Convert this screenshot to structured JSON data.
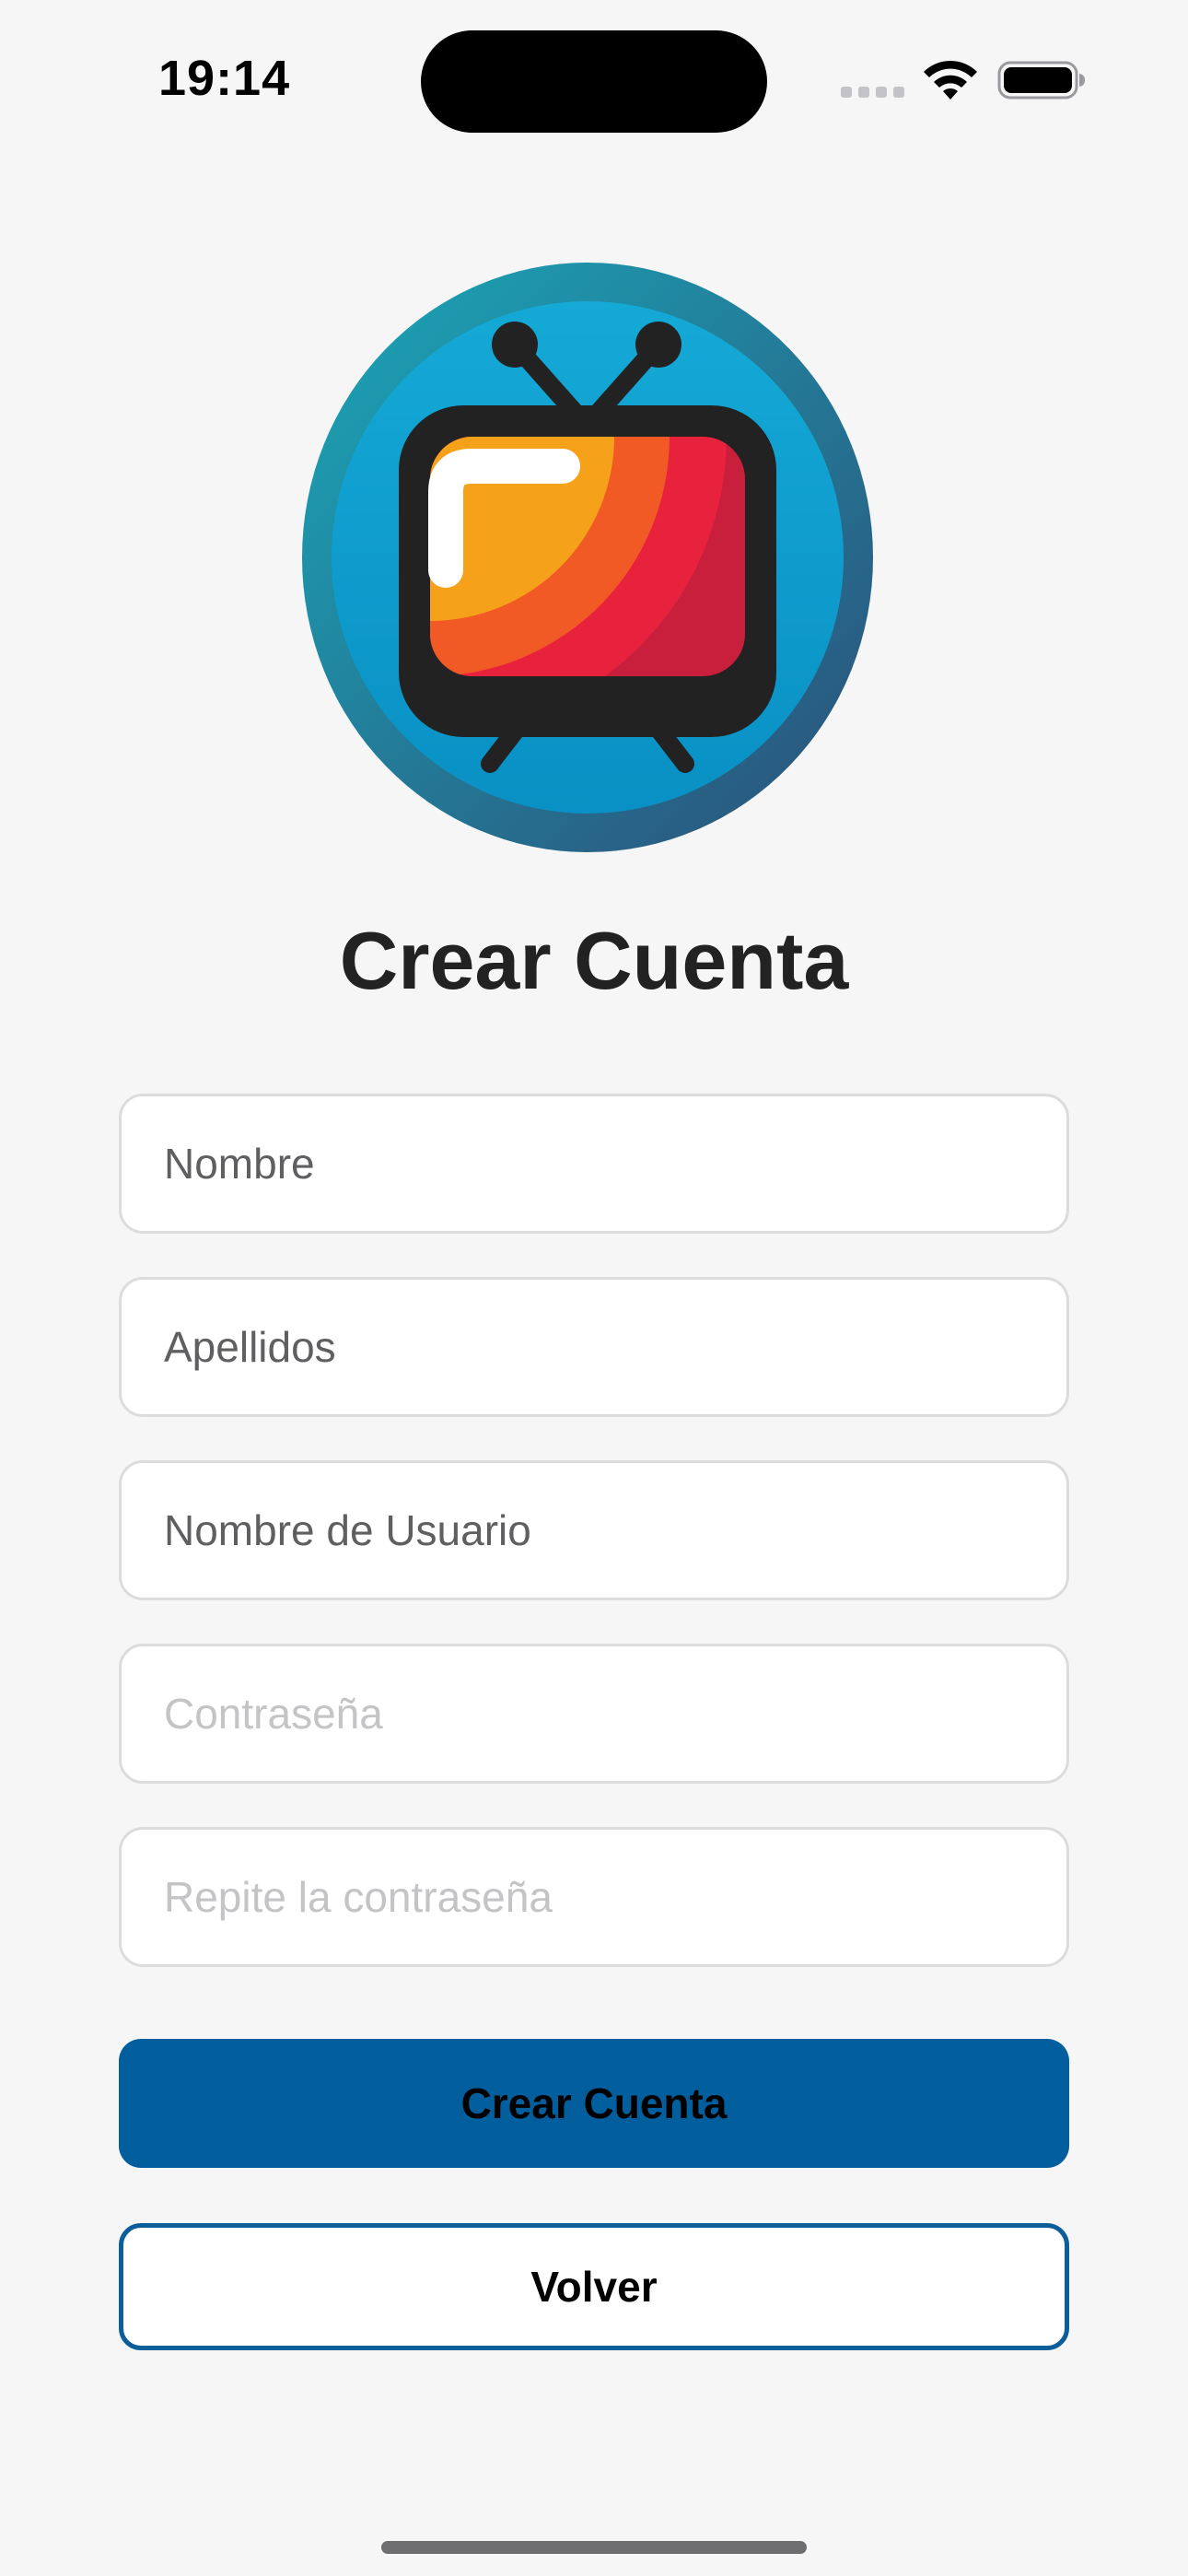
{
  "status_bar": {
    "time": "19:14",
    "icons": [
      "signal-icon",
      "wifi-icon",
      "battery-icon"
    ]
  },
  "logo": {
    "icon": "retro-tv-logo-icon",
    "colors": {
      "ring_outer": "#2a5a80",
      "ring_inner": "#0e9ccc",
      "frame": "#222222",
      "screen_red": "#e8213d",
      "screen_dark_red": "#c71f3c",
      "screen_orange": "#f15a24",
      "screen_yellow": "#f6a11a"
    }
  },
  "title": "Crear Cuenta",
  "form": {
    "fields": [
      {
        "name": "nombre",
        "placeholder": "Nombre",
        "value": ""
      },
      {
        "name": "apellidos",
        "placeholder": "Apellidos",
        "value": ""
      },
      {
        "name": "usuario",
        "placeholder": "Nombre de Usuario",
        "value": ""
      },
      {
        "name": "password",
        "placeholder": "Contraseña",
        "value": ""
      },
      {
        "name": "password_repeat",
        "placeholder": "Repite la contraseña",
        "value": ""
      }
    ]
  },
  "buttons": {
    "create_label": "Crear Cuenta",
    "back_label": "Volver"
  },
  "colors": {
    "background": "#f6f6f7",
    "primary_button": "#025e9c",
    "secondary_border": "#0b5e9a",
    "field_border": "#dcdcde"
  }
}
